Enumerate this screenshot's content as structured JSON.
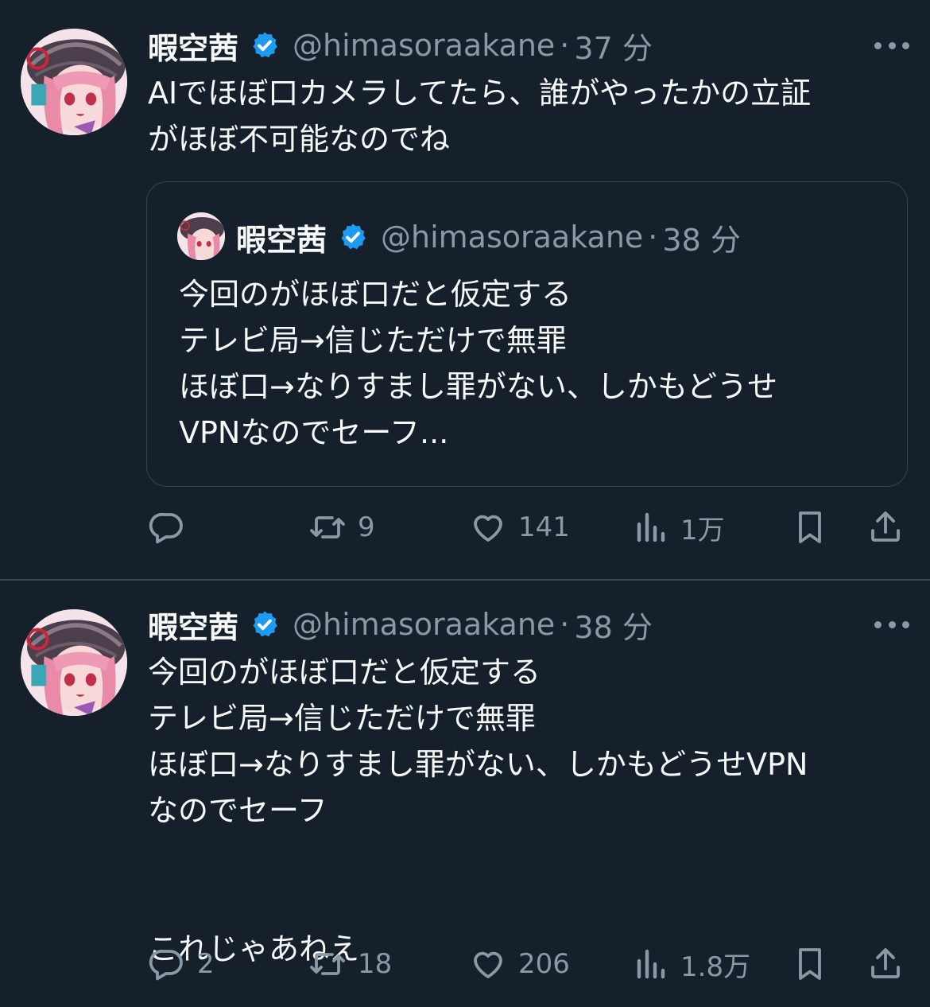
{
  "tweets": [
    {
      "author": {
        "name": "暇空茜",
        "handle": "@himasoraakane",
        "time": "37 分"
      },
      "text": "AIでほぼ口カメラしてたら、誰がやったかの立証\nがほぼ不可能なのでね",
      "quote": {
        "author": {
          "name": "暇空茜",
          "handle": "@himasoraakane",
          "time": "38 分"
        },
        "text": "今回のがほぼ口だと仮定する\nテレビ局→信じただけで無罪\nほぼ口→なりすまし罪がない、しかもどうせ\nVPNなのでセーフ..."
      },
      "actions": {
        "replies": "",
        "retweets": "9",
        "likes": "141",
        "views": "1万"
      }
    },
    {
      "author": {
        "name": "暇空茜",
        "handle": "@himasoraakane",
        "time": "38 分"
      },
      "text": "今回のがほぼ口だと仮定する\nテレビ局→信じただけで無罪\nほぼ口→なりすまし罪がない、しかもどうせVPN\nなのでセーフ\n\n\nこれじゃあねえ",
      "actions": {
        "replies": "2",
        "retweets": "18",
        "likes": "206",
        "views": "1.8万"
      }
    }
  ],
  "separator": "·",
  "icons": {
    "verified": "verified-badge-icon",
    "more": "more-dots-icon",
    "reply": "reply-bubble-icon",
    "retweet": "retweet-arrows-icon",
    "like": "heart-icon",
    "views": "bar-chart-icon",
    "bookmark": "bookmark-icon",
    "share": "share-upload-icon"
  },
  "colors": {
    "background": "#15202b",
    "text": "#f7f9f9",
    "muted": "#8b98a5",
    "verified": "#1d9bf0",
    "border": "#38444d"
  }
}
